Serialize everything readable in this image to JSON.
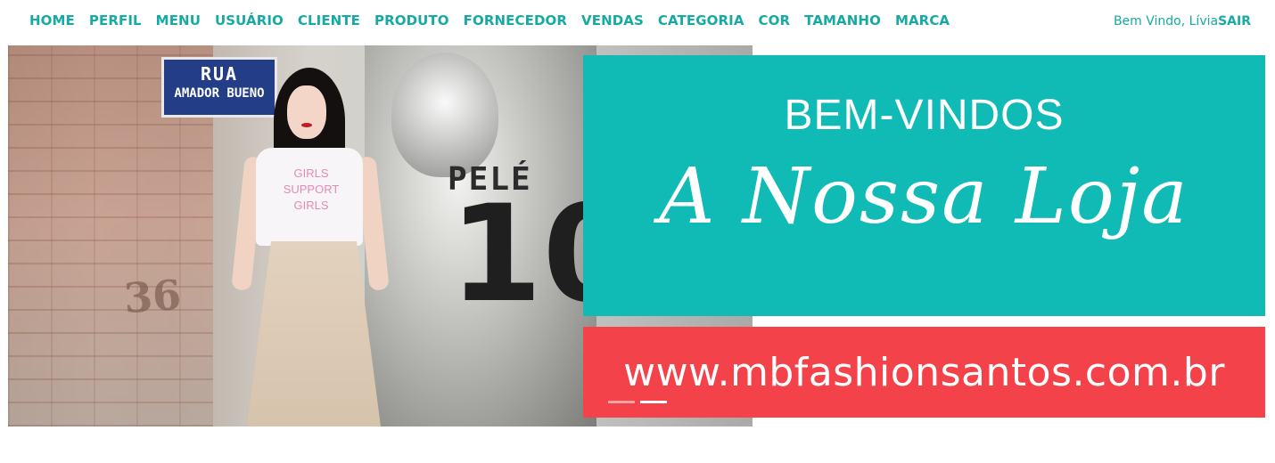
{
  "nav": {
    "items": [
      "HOME",
      "PERFIL",
      "MENU",
      "USUÁRIO",
      "CLIENTE",
      "PRODUTO",
      "FORNECEDOR",
      "VENDAS",
      "CATEGORIA",
      "COR",
      "TAMANHO",
      "MARCA"
    ],
    "welcome_text": "Bem Vindo, Lívia",
    "logout_label": "SAIR",
    "accent_color": "#17a9a3"
  },
  "banner": {
    "street_sign": {
      "line1": "RUA",
      "line2": "AMADOR BUENO"
    },
    "shirt_print": "GIRLS SUPPORT GIRLS",
    "jersey_name": "PELÉ",
    "jersey_number": "10",
    "wall_number": "36",
    "headline": "BEM-VINDOS",
    "tagline": "A Nossa Loja",
    "url": "www.mbfashionsantos.com.br",
    "teal_color": "#10bab5",
    "red_color": "#f4424a",
    "slide_count": 2,
    "active_slide": 2
  }
}
